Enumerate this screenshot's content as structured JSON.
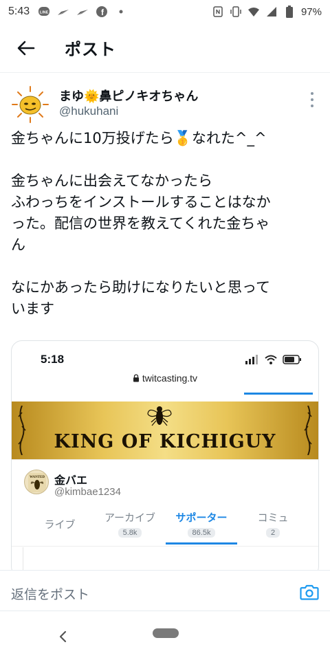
{
  "status_bar": {
    "time": "5:43",
    "battery": "97%",
    "left_icons": [
      "line-icon",
      "send-icon",
      "send-icon",
      "facebook-icon",
      "dot-icon"
    ],
    "right_icons": [
      "nfc-icon",
      "vibrate-icon",
      "wifi-icon",
      "signal-icon",
      "battery-icon"
    ]
  },
  "header": {
    "title": "ポスト",
    "back_icon": "arrow-left-icon"
  },
  "tweet": {
    "display_name": "まゆ🌞鼻ピノキオちゃん",
    "handle": "@hukuhani",
    "lines": [
      "金ちゃんに10万投げたら🥇なれた^_^",
      "",
      "金ちゃんに出会えてなかったら",
      "ふわっちをインストールすることはなか",
      "った。配信の世界を教えてくれた金ちゃ",
      "ん",
      "",
      "なにかあったら助けになりたいと思って",
      "います"
    ]
  },
  "embedded": {
    "time": "5:18",
    "url": "twitcasting.tv",
    "banner_text": "KING OF KICHIGUY",
    "profile_name": "金バエ",
    "profile_id": "@kimbae1234",
    "tabs": [
      {
        "label": "ライブ",
        "count": ""
      },
      {
        "label": "アーカイブ",
        "count": "5.8k"
      },
      {
        "label": "サポーター",
        "count": "86.5k"
      },
      {
        "label": "コミュ",
        "count": "2"
      }
    ],
    "active_tab": 2
  },
  "reply": {
    "placeholder": "返信をポスト",
    "icon": "camera-icon"
  },
  "colors": {
    "accent": "#1d9bf0",
    "tab_active": "#1d87e4",
    "gold": "#e8c558"
  }
}
